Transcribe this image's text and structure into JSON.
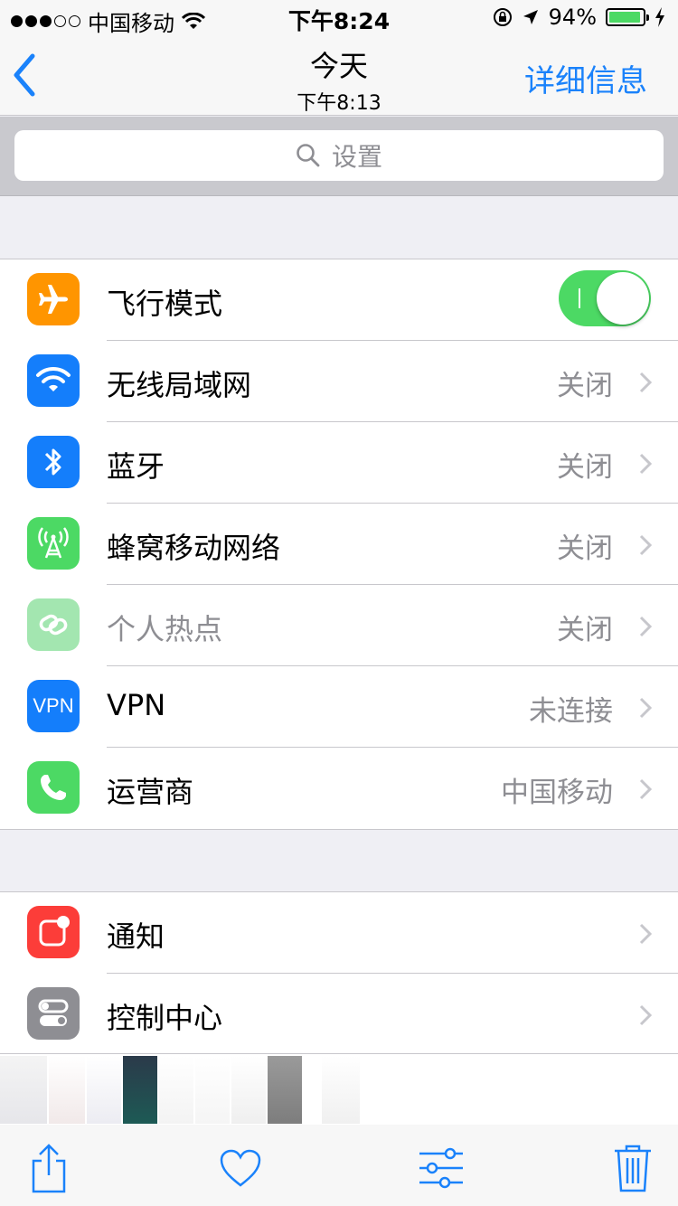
{
  "status_bar": {
    "carrier": "中国移动",
    "time": "下午8:24",
    "battery": "94%",
    "battery_level": 0.94,
    "signal_strength": 3
  },
  "nav": {
    "title": "今天",
    "subtitle": "下午8:13",
    "detail_label": "详细信息"
  },
  "search": {
    "placeholder": "设置"
  },
  "group1": [
    {
      "label": "飞行模式",
      "value": "",
      "icon": "airplane-icon",
      "color": "#ff9500",
      "toggle_on": true
    },
    {
      "label": "无线局域网",
      "value": "关闭",
      "icon": "wifi-icon",
      "color": "#147efb"
    },
    {
      "label": "蓝牙",
      "value": "关闭",
      "icon": "bluetooth-icon",
      "color": "#147efb"
    },
    {
      "label": "蜂窝移动网络",
      "value": "关闭",
      "icon": "cellular-icon",
      "color": "#4cd964"
    },
    {
      "label": "个人热点",
      "value": "关闭",
      "icon": "hotspot-icon",
      "color": "#a3e6b0"
    },
    {
      "label": "VPN",
      "value": "未连接",
      "icon": "vpn-icon",
      "color": "#147efb",
      "icon_text": "VPN"
    },
    {
      "label": "运营商",
      "value": "中国移动",
      "icon": "phone-icon",
      "color": "#4cd964"
    }
  ],
  "group2": [
    {
      "label": "通知",
      "icon": "notifications-icon",
      "color": "#fc3d39"
    },
    {
      "label": "控制中心",
      "icon": "control-center-icon",
      "color": "#8e8e93"
    }
  ],
  "colors": {
    "accent": "#1a82fb",
    "toggle_on": "#4cd964",
    "secondary_text": "#8e8e93"
  }
}
